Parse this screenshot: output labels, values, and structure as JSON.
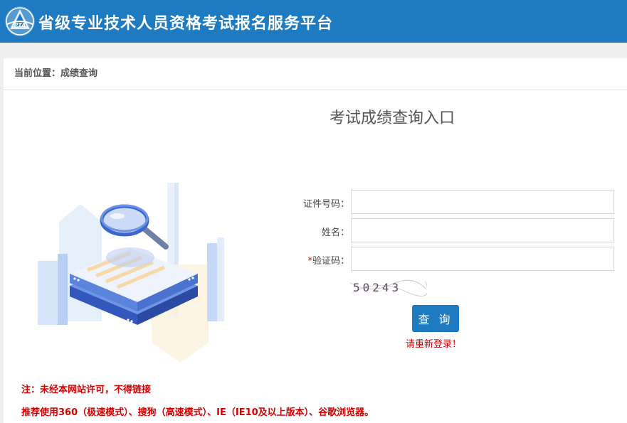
{
  "header": {
    "logo_text": "PTA",
    "site_title": "省级专业技术人员资格考试报名服务平台"
  },
  "breadcrumb": {
    "text": "当前位置：成绩查询"
  },
  "form": {
    "title": "考试成绩查询入口",
    "id_label": "证件号码：",
    "name_label": "姓名：",
    "captcha_required_mark": "*",
    "captcha_label": "验证码：",
    "id_value": "",
    "name_value": "",
    "captcha_value": "",
    "captcha_image_text": "50243",
    "query_button": "查 询",
    "login_message": "请重新登录！"
  },
  "notes": {
    "line1": "注：未经本网站许可，不得链接",
    "line2": "推荐使用360（极速模式）、搜狗（高速模式）、IE（IE10及以上版本）、谷歌浏览器。"
  },
  "colors": {
    "brand_blue": "#1e7ac1",
    "warning_red": "#d40000"
  }
}
